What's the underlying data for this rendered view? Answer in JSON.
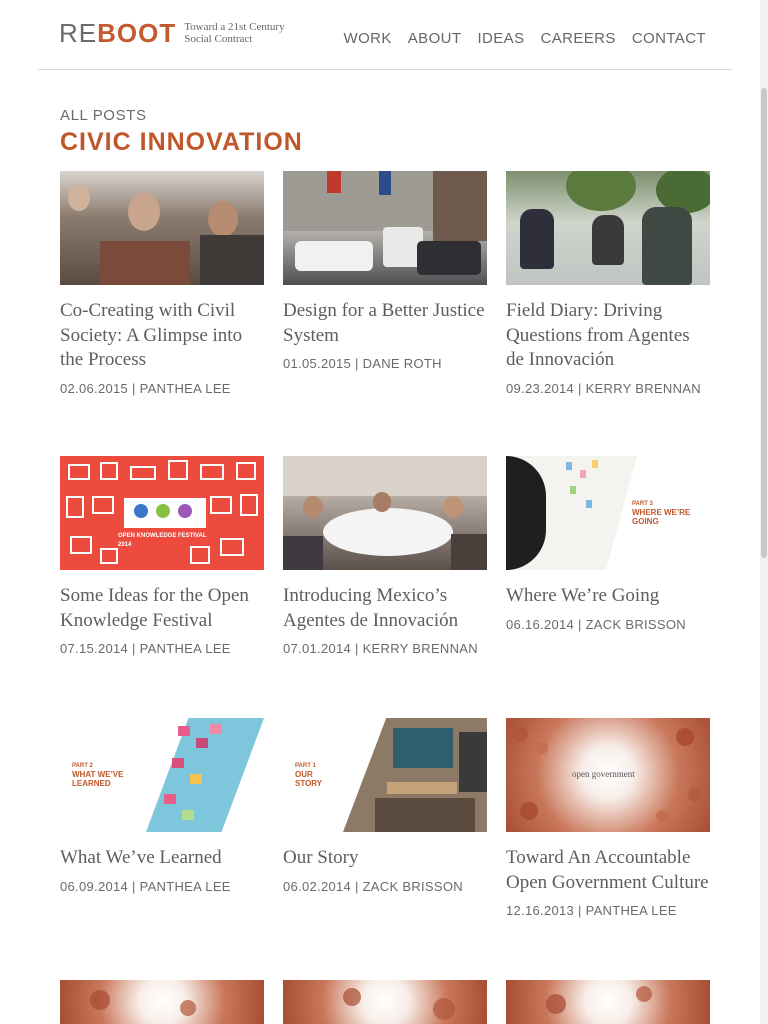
{
  "site": {
    "logo_re": "RE",
    "logo_boot": "BOOT",
    "tagline": "Toward a 21st Century Social Contract"
  },
  "nav": [
    "WORK",
    "ABOUT",
    "IDEAS",
    "CAREERS",
    "CONTACT"
  ],
  "breadcrumb": "ALL POSTS",
  "page_title": "CIVIC INNOVATION",
  "posts": [
    {
      "title": "Co-Creating with Civil Society: A Glimpse into the Process",
      "meta": "02.06.2015 | PANTHEA LEE"
    },
    {
      "title": "Design for a Better Justice System",
      "meta": "01.05.2015 | DANE ROTH"
    },
    {
      "title": "Field Diary: Driving Questions from Agentes de Innovación",
      "meta": "09.23.2014 | KERRY BRENNAN"
    },
    {
      "title": "Some Ideas for the Open Knowledge Festival",
      "meta": "07.15.2014 | PANTHEA LEE"
    },
    {
      "title": "Introducing Mexico’s Agentes de Innovación",
      "meta": "07.01.2014 | KERRY BRENNAN"
    },
    {
      "title": "Where We’re Going",
      "meta": "06.16.2014 | ZACK BRISSON"
    },
    {
      "title": "What We’ve Learned",
      "meta": "06.09.2014 | PANTHEA LEE"
    },
    {
      "title": "Our Story",
      "meta": "06.02.2014 | ZACK BRISSON"
    },
    {
      "title": "Toward An Accountable Open Government Culture",
      "meta": "12.16.2013 | PANTHEA LEE"
    }
  ],
  "thumb_text": {
    "okfest": "OPEN KNOWLEDGE FESTIVAL 2014",
    "going_part": "PART 3",
    "going": "WHERE WE’RE GOING",
    "learned_part": "PART 2",
    "learned": "WHAT WE’VE LEARNED",
    "story_part": "PART 1",
    "story": "OUR STORY",
    "opengov": "open government"
  },
  "colors": {
    "accent": "#c0572b",
    "okfest_red": "#ee4b3f"
  }
}
